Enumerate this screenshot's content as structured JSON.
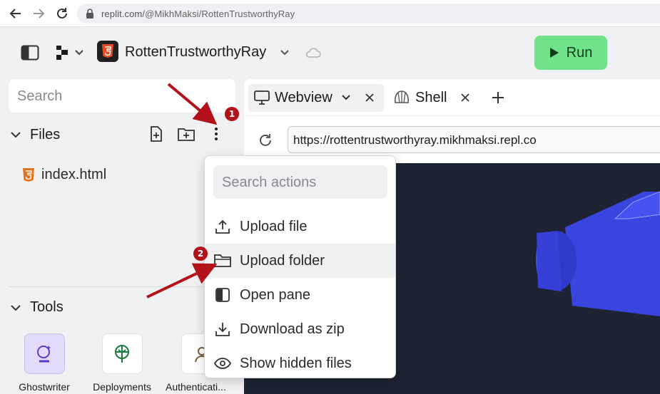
{
  "browser": {
    "url_host": "replit.com",
    "url_path": "/@MikhMaksi/RottenTrustworthyRay"
  },
  "header": {
    "repl_name": "RottenTrustworthyRay",
    "run_label": "Run"
  },
  "sidebar": {
    "search_placeholder": "Search",
    "files_title": "Files",
    "files": [
      {
        "name": "index.html"
      }
    ],
    "tools_title": "Tools",
    "tools": [
      {
        "label": "Ghostwriter"
      },
      {
        "label": "Deployments"
      },
      {
        "label": "Authenticati..."
      }
    ]
  },
  "pane": {
    "tabs": [
      {
        "label": "Webview"
      },
      {
        "label": "Shell"
      }
    ],
    "webview_url": "https://rottentrustworthyray.mikhmaksi.repl.co"
  },
  "menu": {
    "search_placeholder": "Search actions",
    "items": [
      {
        "label": "Upload file"
      },
      {
        "label": "Upload folder"
      },
      {
        "label": "Open pane"
      },
      {
        "label": "Download as zip"
      },
      {
        "label": "Show hidden files"
      }
    ]
  },
  "annotations": {
    "badge_1": "1",
    "badge_2": "2"
  },
  "colors": {
    "run_button": "#6fe28a",
    "annotation": "#b3121b",
    "preview_bg": "#1e2333",
    "preview_shape": "#3a45e0"
  }
}
